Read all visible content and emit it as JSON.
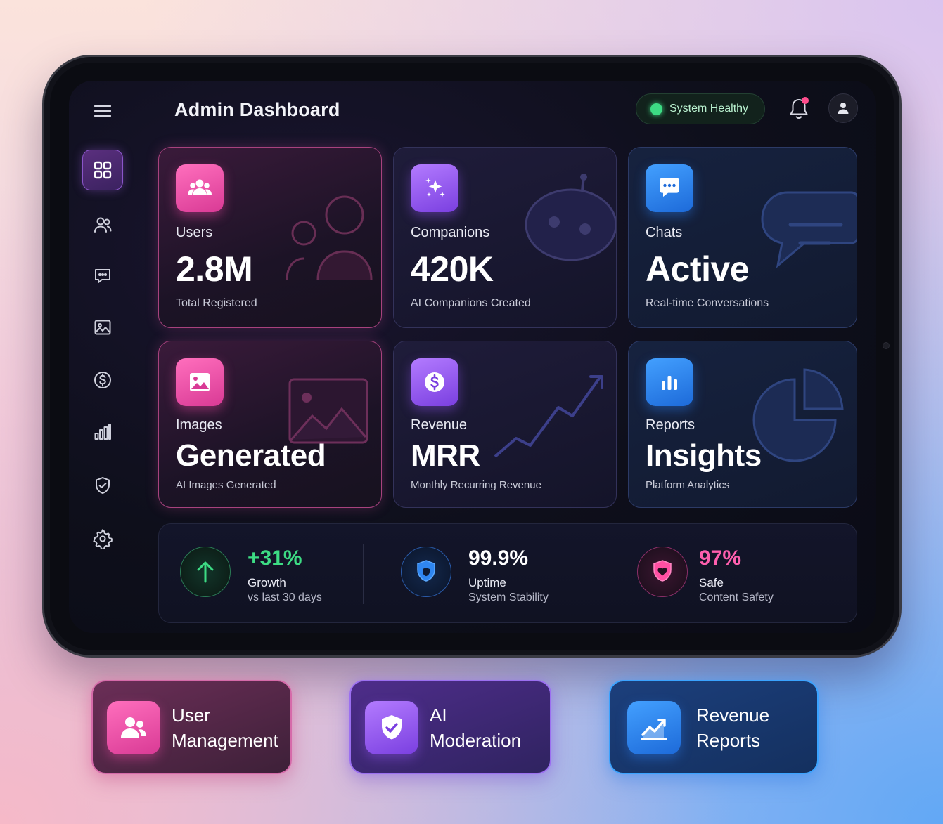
{
  "header": {
    "title": "Admin Dashboard",
    "status": "System Healthy"
  },
  "sidebar": {
    "items": [
      {
        "icon": "menu-icon"
      },
      {
        "icon": "dashboard-grid-icon",
        "active": true
      },
      {
        "icon": "users-icon"
      },
      {
        "icon": "chat-icon"
      },
      {
        "icon": "image-icon"
      },
      {
        "icon": "dollar-icon"
      },
      {
        "icon": "bar-chart-icon"
      },
      {
        "icon": "shield-check-icon"
      },
      {
        "icon": "settings-gear-icon"
      }
    ]
  },
  "cards": [
    {
      "label": "Users",
      "value": "2.8M",
      "sub": "Total Registered",
      "icon": "users-icon",
      "color": "#e0479e"
    },
    {
      "label": "Companions",
      "value": "420K",
      "sub": "AI Companions Created",
      "icon": "sparkles-icon",
      "color": "#8e4ff0"
    },
    {
      "label": "Chats",
      "value": "Active",
      "sub": "Real-time Conversations",
      "icon": "chat-bubble-icon",
      "color": "#2b82f0"
    },
    {
      "label": "Images",
      "value": "Generated",
      "sub": "AI Images Generated",
      "icon": "image-icon",
      "color": "#e0479e"
    },
    {
      "label": "Revenue",
      "value": "MRR",
      "sub": "Monthly Recurring Revenue",
      "icon": "dollar-icon",
      "color": "#8e4ff0"
    },
    {
      "label": "Reports",
      "value": "Insights",
      "sub": "Platform Analytics",
      "icon": "bar-chart-icon",
      "color": "#2b82f0"
    }
  ],
  "stats": [
    {
      "value": "+31%",
      "label": "Growth",
      "sub": "vs last 30 days",
      "color": "#3ddc84",
      "icon": "arrow-up-icon"
    },
    {
      "value": "99.9%",
      "label": "Uptime",
      "sub": "System Stability",
      "color": "#ffffff",
      "icon": "shield-icon"
    },
    {
      "value": "97%",
      "label": "Safe",
      "sub": "Content Safety",
      "color": "#ff5fae",
      "icon": "shield-heart-icon"
    }
  ],
  "quick_actions": [
    {
      "line1": "User",
      "line2": "Management",
      "icon": "users-icon"
    },
    {
      "line1": "AI",
      "line2": "Moderation",
      "icon": "shield-check-icon"
    },
    {
      "line1": "Revenue",
      "line2": "Reports",
      "icon": "trend-chart-icon"
    }
  ],
  "colors": {
    "pink": "#e0479e",
    "violet": "#8e4ff0",
    "blue": "#2b82f0",
    "green": "#3ddc84"
  }
}
